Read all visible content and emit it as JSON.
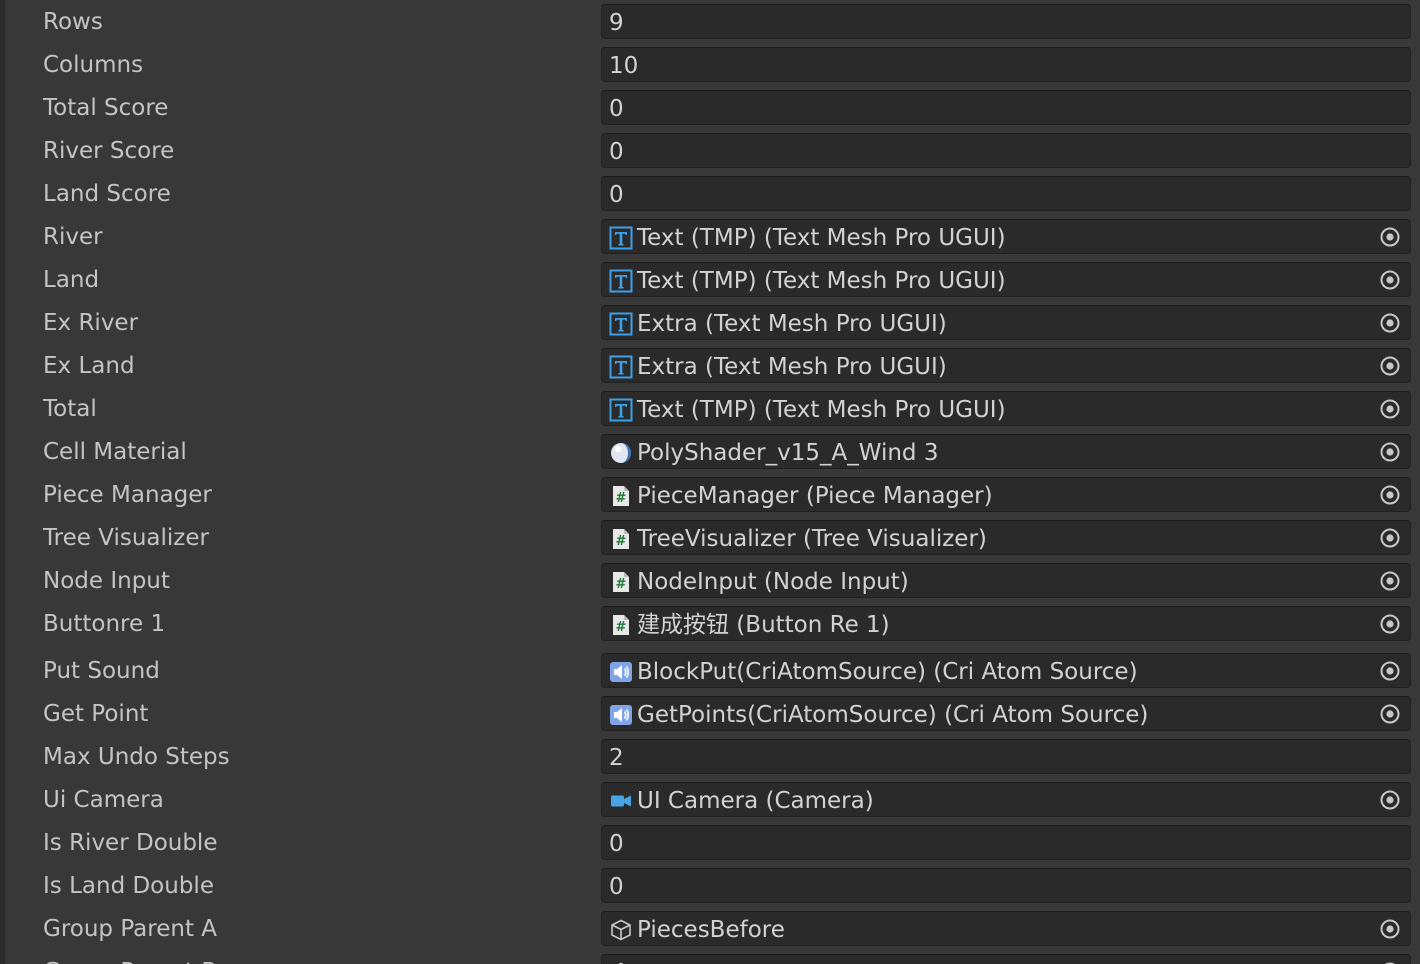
{
  "inspector": {
    "fields": [
      {
        "label": "Rows",
        "value": "9",
        "kind": "number"
      },
      {
        "label": "Columns",
        "value": "10",
        "kind": "number"
      },
      {
        "label": "Total Score",
        "value": "0",
        "kind": "number"
      },
      {
        "label": "River Score",
        "value": "0",
        "kind": "number"
      },
      {
        "label": "Land Score",
        "value": "0",
        "kind": "number"
      },
      {
        "label": "River",
        "value": "Text (TMP) (Text Mesh Pro UGUI)",
        "kind": "object",
        "icon": "tmp-text-icon"
      },
      {
        "label": "Land",
        "value": "Text (TMP) (Text Mesh Pro UGUI)",
        "kind": "object",
        "icon": "tmp-text-icon"
      },
      {
        "label": "Ex River",
        "value": "Extra (Text Mesh Pro UGUI)",
        "kind": "object",
        "icon": "tmp-text-icon"
      },
      {
        "label": "Ex Land",
        "value": "Extra (Text Mesh Pro UGUI)",
        "kind": "object",
        "icon": "tmp-text-icon"
      },
      {
        "label": "Total",
        "value": "Text (TMP) (Text Mesh Pro UGUI)",
        "kind": "object",
        "icon": "tmp-text-icon"
      },
      {
        "label": "Cell Material",
        "value": "PolyShader_v15_A_Wind 3",
        "kind": "object",
        "icon": "material-icon"
      },
      {
        "label": "Piece Manager",
        "value": "PieceManager (Piece Manager)",
        "kind": "object",
        "icon": "script-icon"
      },
      {
        "label": "Tree Visualizer",
        "value": "TreeVisualizer (Tree Visualizer)",
        "kind": "object",
        "icon": "script-icon"
      },
      {
        "label": "Node Input",
        "value": "NodeInput (Node Input)",
        "kind": "object",
        "icon": "script-icon"
      },
      {
        "label": "Buttonre 1",
        "value": "建成按钮 (Button Re 1)",
        "kind": "object",
        "icon": "script-icon"
      },
      {
        "label": "Put Sound",
        "value": "BlockPut(CriAtomSource) (Cri Atom Source)",
        "kind": "object",
        "icon": "audio-source-icon"
      },
      {
        "label": "Get Point",
        "value": "GetPoints(CriAtomSource) (Cri Atom Source)",
        "kind": "object",
        "icon": "audio-source-icon"
      },
      {
        "label": "Max Undo Steps",
        "value": "2",
        "kind": "number"
      },
      {
        "label": "Ui Camera",
        "value": "UI Camera (Camera)",
        "kind": "object",
        "icon": "camera-icon"
      },
      {
        "label": "Is River Double",
        "value": "0",
        "kind": "number"
      },
      {
        "label": "Is Land Double",
        "value": "0",
        "kind": "number"
      },
      {
        "label": "Group Parent A",
        "value": "PiecesBefore",
        "kind": "object",
        "icon": "gameobject-icon"
      },
      {
        "label": "Group Parent B",
        "value": "",
        "kind": "object",
        "icon": "gameobject-icon"
      }
    ],
    "colors": {
      "background": "#383838",
      "field_background": "#2a2a2a",
      "label_text": "#c4c4c4",
      "value_text": "#d2d2d2",
      "tmp_icon": "#3ea0e6",
      "script_icon_bg": "#e8e8e8",
      "script_icon_glyph": "#1f7a38",
      "audio_icon": "#7fa4e8",
      "camera_icon": "#49a4e6"
    }
  }
}
